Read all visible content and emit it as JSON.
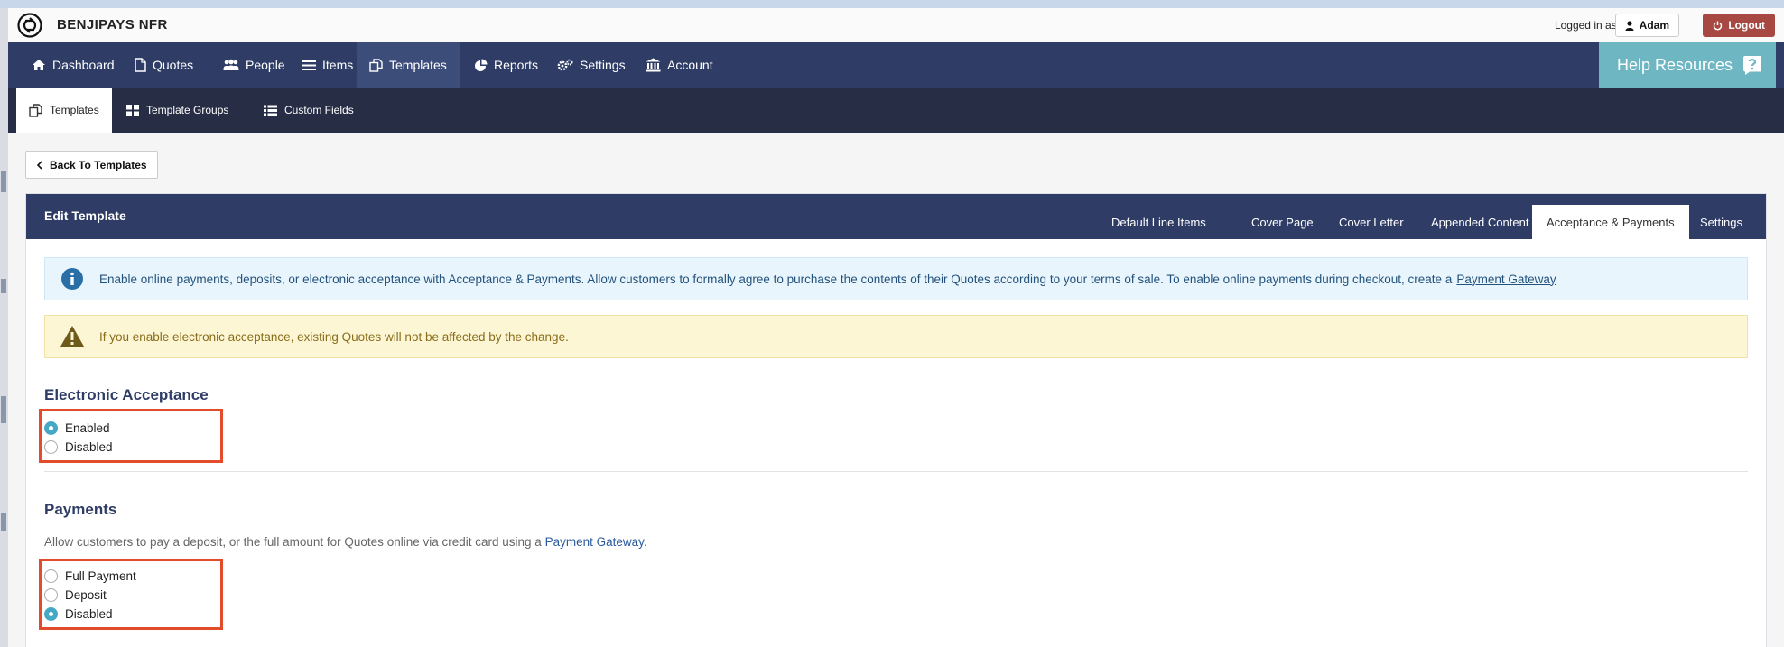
{
  "app": {
    "brand": "BENJIPAYS NFR",
    "logged_in_label": "Logged in as:",
    "user_name": "Adam",
    "logout_label": "Logout"
  },
  "main_nav": {
    "items": [
      {
        "label": "Dashboard",
        "icon": "home-icon"
      },
      {
        "label": "Quotes",
        "icon": "document-icon"
      },
      {
        "label": "People",
        "icon": "users-icon"
      },
      {
        "label": "Items",
        "icon": "list-icon"
      },
      {
        "label": "Templates",
        "icon": "copy-icon",
        "active": true
      },
      {
        "label": "Reports",
        "icon": "pie-chart-icon"
      },
      {
        "label": "Settings",
        "icon": "gears-icon"
      },
      {
        "label": "Account",
        "icon": "bank-icon"
      }
    ],
    "help_label": "Help Resources"
  },
  "sub_nav": {
    "items": [
      {
        "label": "Templates",
        "icon": "copy-icon",
        "active": true
      },
      {
        "label": "Template Groups",
        "icon": "grid-icon"
      },
      {
        "label": "Custom Fields",
        "icon": "list-icon"
      }
    ]
  },
  "back_button": "Back To Templates",
  "panel": {
    "title": "Edit Template",
    "tabs": [
      {
        "label": "Default Line Items"
      },
      {
        "label": "Cover Page"
      },
      {
        "label": "Cover Letter"
      },
      {
        "label": "Appended Content"
      },
      {
        "label": "Acceptance & Payments",
        "active": true
      },
      {
        "label": "Settings"
      }
    ]
  },
  "info_alert": {
    "text": "Enable online payments, deposits, or electronic acceptance with Acceptance & Payments. Allow customers to formally agree to purchase the contents of their Quotes according to your terms of sale. To enable online payments during checkout, create a",
    "link": "Payment Gateway"
  },
  "warning_alert": {
    "text": "If you enable electronic acceptance, existing Quotes will not be affected by the change."
  },
  "electronic_acceptance": {
    "title": "Electronic Acceptance",
    "options": [
      {
        "label": "Enabled",
        "checked": true
      },
      {
        "label": "Disabled",
        "checked": false
      }
    ]
  },
  "payments": {
    "title": "Payments",
    "description": "Allow customers to pay a deposit, or the full amount for Quotes online via credit card using a",
    "description_link": "Payment Gateway",
    "description_end": ".",
    "options": [
      {
        "label": "Full Payment",
        "checked": false
      },
      {
        "label": "Deposit",
        "checked": false
      },
      {
        "label": "Disabled",
        "checked": true
      }
    ]
  },
  "colors": {
    "nav_bg": "#2f3d66",
    "subnav_bg": "#262d44",
    "help_bg": "#6fb6c3",
    "logout_bg": "#a84842",
    "highlight": "#e24c2b",
    "radio_on": "#45a9c6"
  }
}
